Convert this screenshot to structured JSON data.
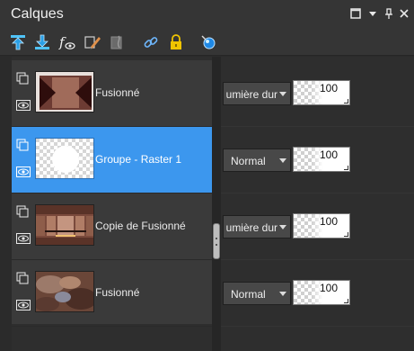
{
  "panel": {
    "title": "Calques",
    "controls": [
      "maximize-icon",
      "dropdown-icon",
      "pin-icon",
      "close-icon"
    ]
  },
  "toolbar": {
    "tools": [
      "move-layer-up-icon",
      "move-layer-down-icon",
      "visibility-toggle-icon",
      "edit-brush-icon",
      "mask-icon",
      "link-icon",
      "lock-icon",
      "layer-effects-icon"
    ]
  },
  "layers": [
    {
      "name": "Fusionné",
      "blend_mode": "umière dur",
      "opacity": "100",
      "selected": false
    },
    {
      "name": "Groupe - Raster 1",
      "blend_mode": "Normal",
      "opacity": "100",
      "selected": true
    },
    {
      "name": "Copie de Fusionné",
      "blend_mode": "umière dur",
      "opacity": "100",
      "selected": false
    },
    {
      "name": "Fusionné",
      "blend_mode": "Normal",
      "opacity": "100",
      "selected": false
    }
  ],
  "colors": {
    "selection": "#3c97ee",
    "panel_bg": "#2e2e2e",
    "toolbar_bg": "#353535"
  }
}
